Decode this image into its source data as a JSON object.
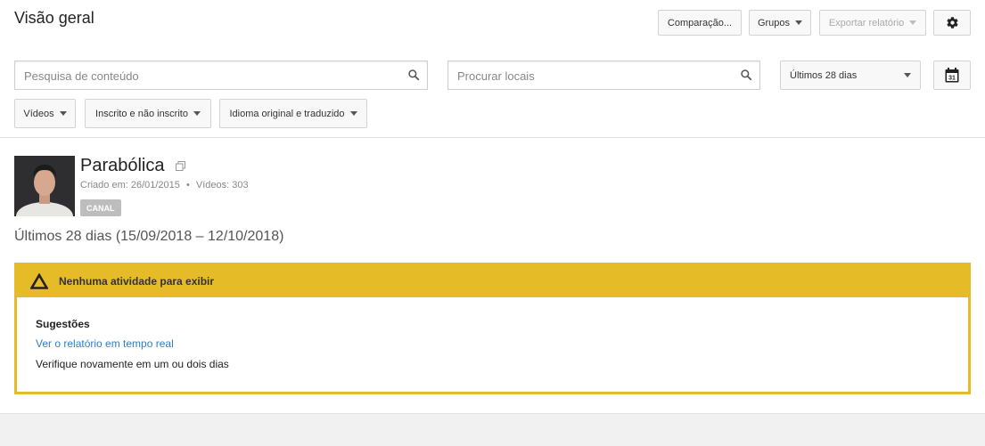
{
  "header": {
    "title": "Visão geral",
    "comparison_label": "Comparação...",
    "groups_label": "Grupos",
    "export_label": "Exportar relatório",
    "settings_icon": "gear-icon"
  },
  "filters": {
    "content_search_placeholder": "Pesquisa de conteúdo",
    "location_search_placeholder": "Procurar locais",
    "date_range_selected": "Últimos 28 dias",
    "calendar_day": "31",
    "content_type": "Vídeos",
    "subscription": "Inscrito e não inscrito",
    "language": "Idioma original e traduzido"
  },
  "channel": {
    "name": "Parabólica",
    "created": "Criado em: 26/01/2015",
    "separator": "•",
    "videos": "Vídeos: 303",
    "badge": "CANAL"
  },
  "period": {
    "label": "Últimos 28 dias (15/09/2018 – 12/10/2018)"
  },
  "alert": {
    "title": "Nenhuma atividade para exibir",
    "suggestions_title": "Sugestões",
    "realtime_link": "Ver o relatório em tempo real",
    "check_again": "Verifique novamente em um ou dois dias",
    "accent_color": "#e6bb28"
  },
  "colors": {
    "link": "#2f7ec5",
    "badge": "#bdbdbd"
  }
}
